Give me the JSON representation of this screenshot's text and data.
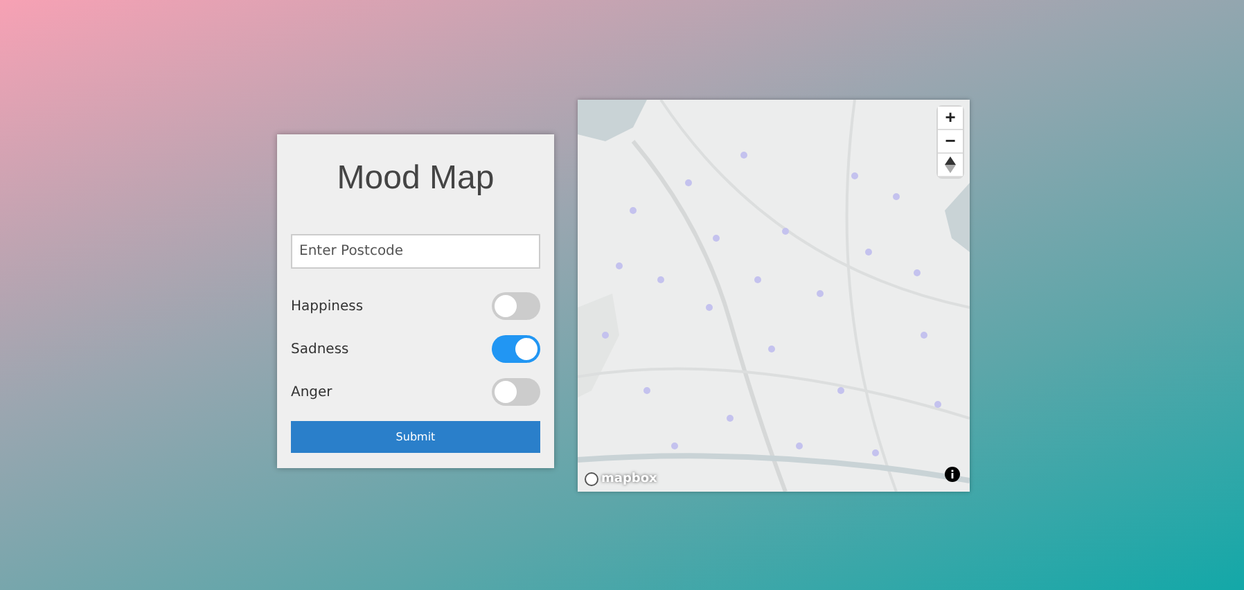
{
  "form": {
    "title": "Mood Map",
    "postcode": {
      "placeholder": "Enter Postcode"
    },
    "moods": [
      {
        "label": "Happiness",
        "on": false
      },
      {
        "label": "Sadness",
        "on": true
      },
      {
        "label": "Anger",
        "on": false
      }
    ],
    "submit": "Submit"
  },
  "map": {
    "zoom_in": "+",
    "zoom_out": "−",
    "logo": "mapbox"
  }
}
